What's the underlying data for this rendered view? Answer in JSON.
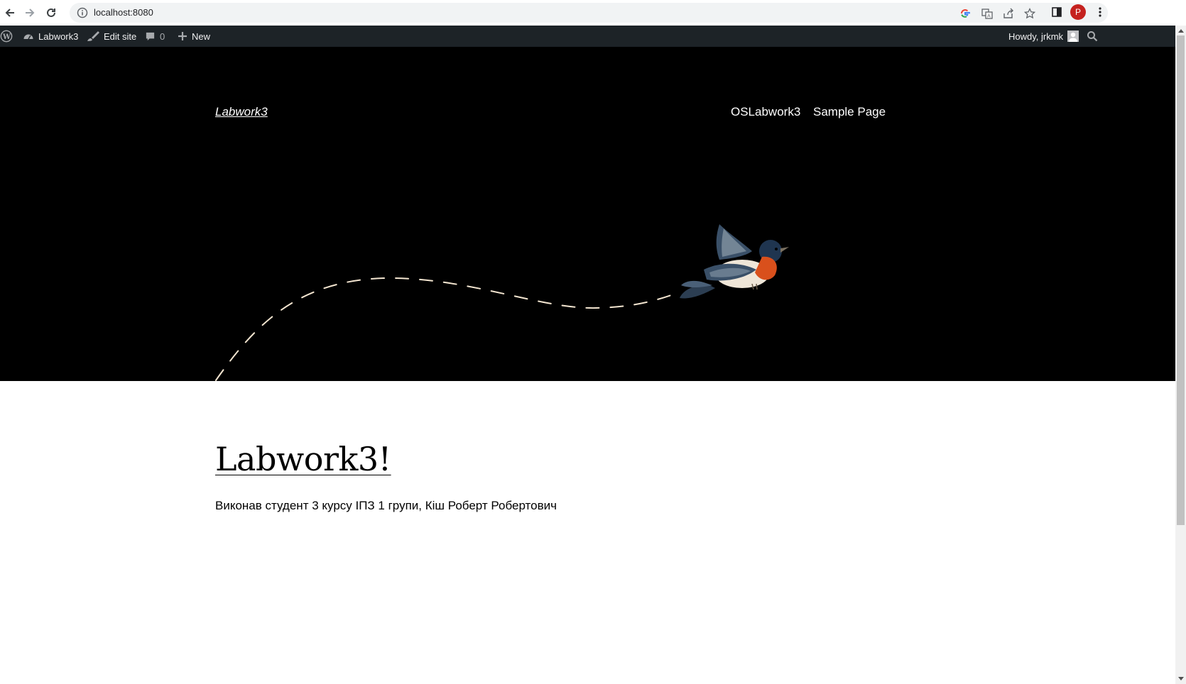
{
  "browser": {
    "url": "localhost:8080",
    "profile_initial": "P"
  },
  "admin_bar": {
    "site_name": "Labwork3",
    "edit_site": "Edit site",
    "comments_count": "0",
    "new_label": "New",
    "howdy": "Howdy, jrkmk"
  },
  "header": {
    "site_title": "Labwork3",
    "menu": [
      "OSLabwork3",
      "Sample Page"
    ]
  },
  "post": {
    "title": "Labwork3!",
    "body": "Виконав студент 3 курсу ІПЗ 1 групи, Кіш Роберт Робертович"
  },
  "colors": {
    "admin_bar_bg": "#1d2327",
    "hero_bg": "#000000",
    "path_stroke": "#f3e5d0",
    "bird_breast": "#d9501c",
    "bird_wing": "#3a5068"
  },
  "icons": {
    "back": "arrow-left-icon",
    "forward": "arrow-right-icon",
    "reload": "reload-icon",
    "site_info": "info-icon",
    "google": "google-icon",
    "translate": "translate-icon",
    "share": "share-icon",
    "bookmark": "star-icon",
    "side_panel": "side-panel-icon",
    "menu": "kebab-menu-icon",
    "wp": "wordpress-logo-icon",
    "dashboard": "dashboard-icon",
    "edit": "brush-icon",
    "comment": "comment-icon",
    "plus": "plus-icon",
    "search": "search-icon"
  }
}
